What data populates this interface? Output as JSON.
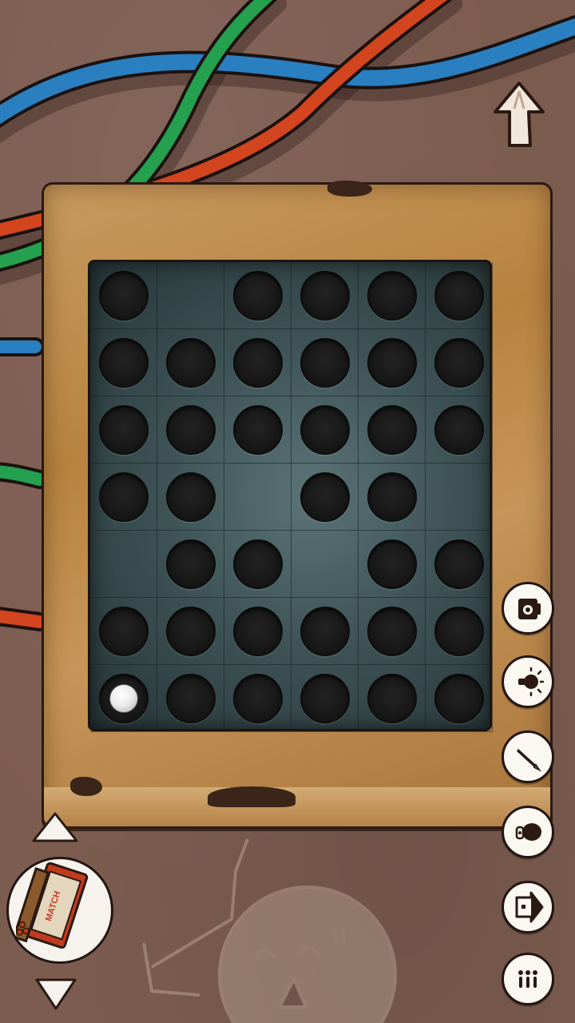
{
  "scene": {
    "background_color": "#7d5c50",
    "wires": [
      {
        "name": "blue-wire",
        "color": "#2a7fc0"
      },
      {
        "name": "green-wire",
        "color": "#25a04f"
      },
      {
        "name": "red-wire",
        "color": "#d2451e"
      }
    ]
  },
  "board": {
    "rows": 7,
    "cols": 6,
    "holes": [
      [
        1,
        0,
        1,
        1,
        1,
        1
      ],
      [
        1,
        1,
        1,
        1,
        1,
        1
      ],
      [
        1,
        1,
        1,
        1,
        1,
        1
      ],
      [
        1,
        1,
        0,
        1,
        1,
        0
      ],
      [
        0,
        1,
        1,
        0,
        1,
        1
      ],
      [
        1,
        1,
        1,
        1,
        1,
        1
      ],
      [
        1,
        1,
        1,
        1,
        1,
        1
      ]
    ],
    "ball": {
      "row": 6,
      "col": 0
    }
  },
  "navigation": {
    "back_icon": "up-arrow-icon"
  },
  "side_menu": [
    {
      "name": "camera-button",
      "icon": "camera-icon"
    },
    {
      "name": "hint-button",
      "icon": "lightbulb-icon"
    },
    {
      "name": "notes-button",
      "icon": "pencil-icon"
    },
    {
      "name": "sound-button",
      "icon": "speaker-icon"
    },
    {
      "name": "exit-button",
      "icon": "exit-door-icon"
    },
    {
      "name": "menu-button",
      "icon": "menu-icon"
    }
  ],
  "inventory": {
    "up_icon": "triangle-up-icon",
    "down_icon": "triangle-down-icon",
    "selected_item": {
      "name": "matchbox",
      "label": "MATCH"
    }
  }
}
